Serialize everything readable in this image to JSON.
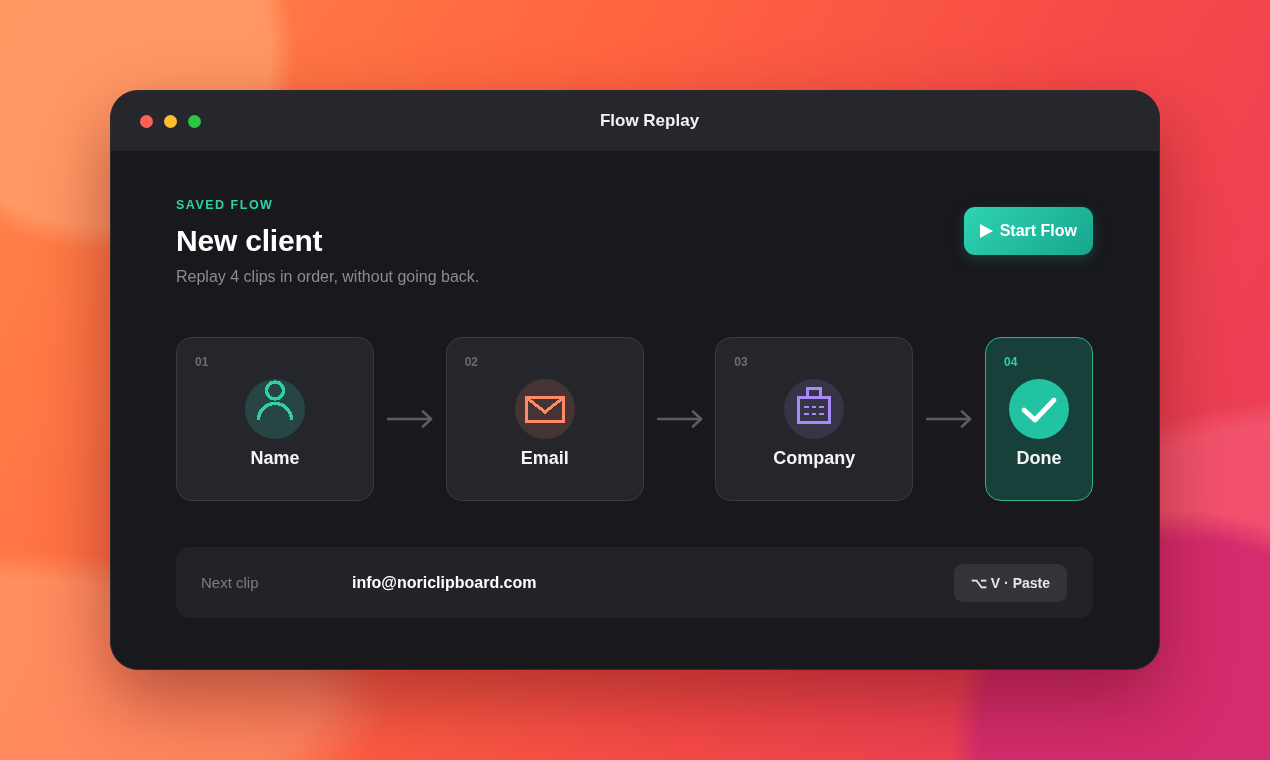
{
  "window": {
    "title": "Flow Replay"
  },
  "header": {
    "eyebrow": "SAVED FLOW",
    "title": "New client",
    "subtitle": "Replay 4 clips in order, without going back.",
    "action": "Start Flow"
  },
  "steps": [
    {
      "number": "01",
      "label": "Name",
      "kind": "person",
      "color": "#2fd0a8",
      "selected": false
    },
    {
      "number": "02",
      "label": "Email",
      "kind": "envelope",
      "color": "#ff8a65",
      "selected": false
    },
    {
      "number": "03",
      "label": "Company",
      "kind": "briefcase",
      "color": "#a78bfa",
      "selected": false
    },
    {
      "number": "04",
      "label": "Done",
      "kind": "check",
      "color": "#22c3a3",
      "selected": true
    }
  ],
  "next_clip": {
    "label": "Next clip",
    "value": "info@noriclipboard.com",
    "shortcut": "⌥ V · Paste"
  }
}
